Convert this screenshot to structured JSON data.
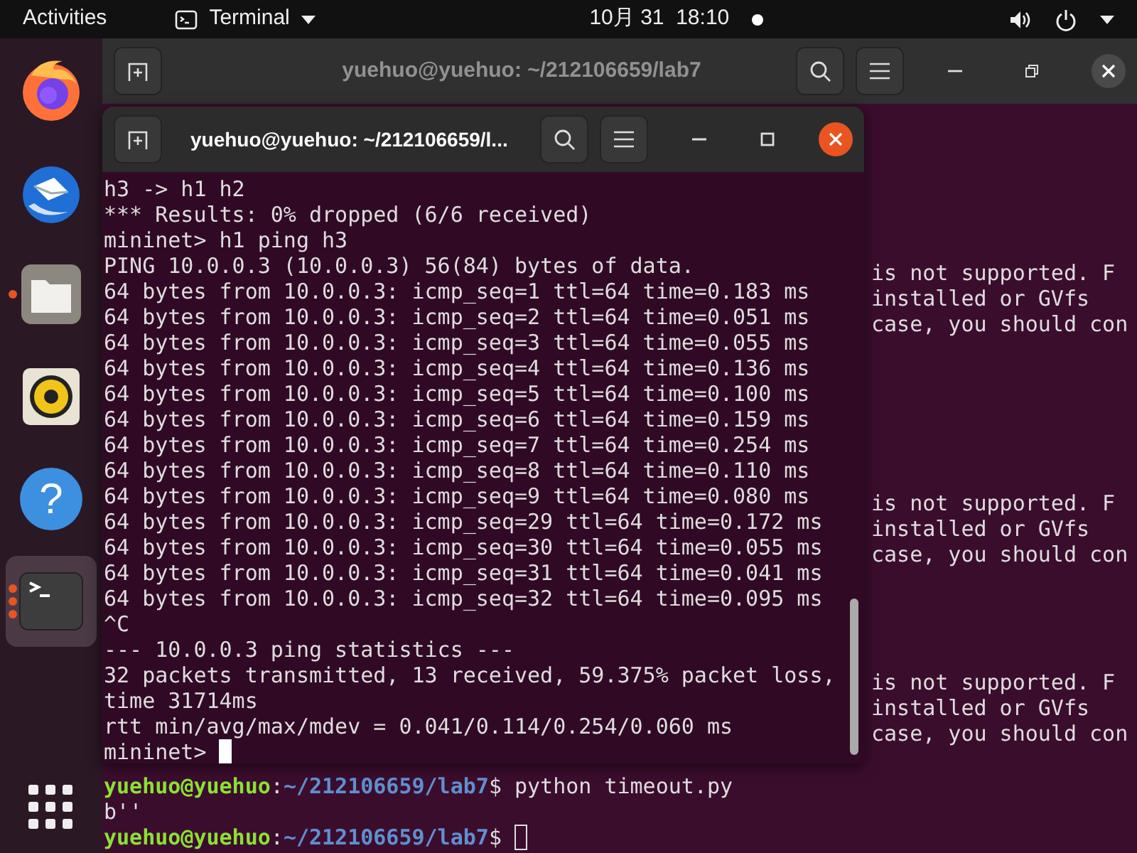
{
  "top_bar": {
    "activities": "Activities",
    "app_menu": "Terminal",
    "clock": "10月 31  18:10",
    "notification_dot": true
  },
  "dock": {
    "items": [
      {
        "kind": "firefox",
        "running": false,
        "selected": false
      },
      {
        "kind": "mail",
        "running": false,
        "selected": false
      },
      {
        "kind": "files",
        "running": true,
        "selected": false
      },
      {
        "kind": "music",
        "running": false,
        "selected": false
      },
      {
        "kind": "help",
        "glyph": "?",
        "running": false,
        "selected": false
      },
      {
        "kind": "terminal",
        "running": true,
        "multiple_windows": true,
        "selected": true
      }
    ]
  },
  "back_window": {
    "title": "yuehuo@yuehuo: ~/212106659/lab7",
    "focused": false,
    "blocks": [
      [
        "is not supported. F",
        "installed or GVfs",
        "case, you should con"
      ],
      [
        "is not supported. F",
        "installed or GVfs",
        "case, you should con"
      ],
      [
        "is not supported. F",
        "installed or GVfs",
        "case, you should con"
      ]
    ],
    "lines": [
      {
        "kind": "prompt",
        "user": "yuehuo@yuehuo",
        "sep": ":",
        "path": "~/212106659/lab7",
        "tail": "$ python timeout.py"
      },
      {
        "kind": "output",
        "text": "b''"
      },
      {
        "kind": "prompt",
        "user": "yuehuo@yuehuo",
        "sep": ":",
        "path": "~/212106659/lab7",
        "tail": "$ ",
        "cursor": true
      }
    ]
  },
  "front_window": {
    "title": "yuehuo@yuehuo: ~/212106659/l...",
    "focused": true,
    "lines": [
      {
        "text": "h3 -> h1 h2"
      },
      {
        "text": "*** Results: 0% dropped (6/6 received)"
      },
      {
        "text": "mininet> h1 ping h3"
      },
      {
        "text": "PING 10.0.0.3 (10.0.0.3) 56(84) bytes of data."
      },
      {
        "text": "64 bytes from 10.0.0.3: icmp_seq=1 ttl=64 time=0.183 ms"
      },
      {
        "text": "64 bytes from 10.0.0.3: icmp_seq=2 ttl=64 time=0.051 ms"
      },
      {
        "text": "64 bytes from 10.0.0.3: icmp_seq=3 ttl=64 time=0.055 ms"
      },
      {
        "text": "64 bytes from 10.0.0.3: icmp_seq=4 ttl=64 time=0.136 ms"
      },
      {
        "text": "64 bytes from 10.0.0.3: icmp_seq=5 ttl=64 time=0.100 ms"
      },
      {
        "text": "64 bytes from 10.0.0.3: icmp_seq=6 ttl=64 time=0.159 ms"
      },
      {
        "text": "64 bytes from 10.0.0.3: icmp_seq=7 ttl=64 time=0.254 ms"
      },
      {
        "text": "64 bytes from 10.0.0.3: icmp_seq=8 ttl=64 time=0.110 ms"
      },
      {
        "text": "64 bytes from 10.0.0.3: icmp_seq=9 ttl=64 time=0.080 ms"
      },
      {
        "text": "64 bytes from 10.0.0.3: icmp_seq=29 ttl=64 time=0.172 ms"
      },
      {
        "text": "64 bytes from 10.0.0.3: icmp_seq=30 ttl=64 time=0.055 ms"
      },
      {
        "text": "64 bytes from 10.0.0.3: icmp_seq=31 ttl=64 time=0.041 ms"
      },
      {
        "text": "64 bytes from 10.0.0.3: icmp_seq=32 ttl=64 time=0.095 ms"
      },
      {
        "text": "^C"
      },
      {
        "text": "--- 10.0.0.3 ping statistics ---"
      },
      {
        "text": "32 packets transmitted, 13 received, 59.375% packet loss,"
      },
      {
        "text": "time 31714ms"
      },
      {
        "text": "rtt min/avg/max/mdev = 0.041/0.114/0.254/0.060 ms"
      },
      {
        "text": "mininet> ",
        "cursor": true
      }
    ]
  }
}
